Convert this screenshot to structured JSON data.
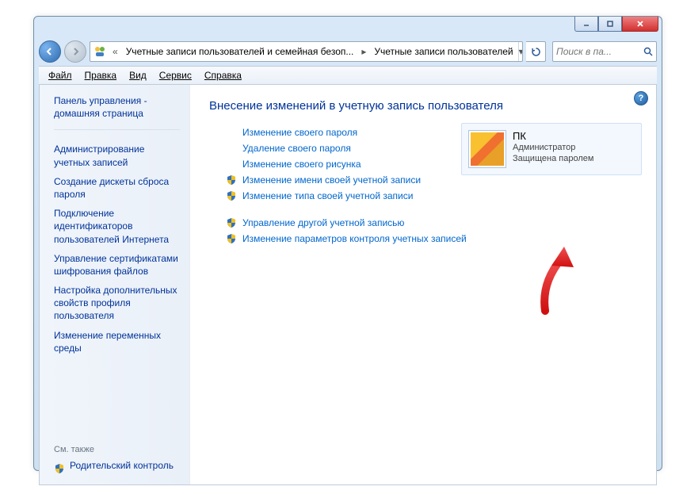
{
  "titlebar": {},
  "breadcrumb": {
    "segment1": "Учетные записи пользователей и семейная безоп...",
    "segment2": "Учетные записи пользователей"
  },
  "search": {
    "placeholder": "Поиск в па..."
  },
  "menu": {
    "file": "Файл",
    "edit": "Правка",
    "view": "Вид",
    "tools": "Сервис",
    "help": "Справка"
  },
  "sidebar": {
    "home": "Панель управления - домашняя страница",
    "links": [
      "Администрирование учетных записей",
      "Создание дискеты сброса пароля",
      "Подключение идентификаторов пользователей Интернета",
      "Управление сертификатами шифрования файлов",
      "Настройка дополнительных свойств профиля пользователя",
      "Изменение переменных среды"
    ],
    "see_also_label": "См. также",
    "see_also_link": "Родительский контроль"
  },
  "content": {
    "heading": "Внесение изменений в учетную запись пользователя",
    "actions": [
      {
        "label": "Изменение своего пароля",
        "shield": false
      },
      {
        "label": "Удаление своего пароля",
        "shield": false
      },
      {
        "label": "Изменение своего рисунка",
        "shield": false
      },
      {
        "label": "Изменение имени своей учетной записи",
        "shield": true
      },
      {
        "label": "Изменение типа своей учетной записи",
        "shield": true
      }
    ],
    "actions2": [
      {
        "label": "Управление другой учетной записью",
        "shield": true
      },
      {
        "label": "Изменение параметров контроля учетных записей",
        "shield": true
      }
    ]
  },
  "user": {
    "name": "ПК",
    "role": "Администратор",
    "status": "Защищена паролем"
  }
}
